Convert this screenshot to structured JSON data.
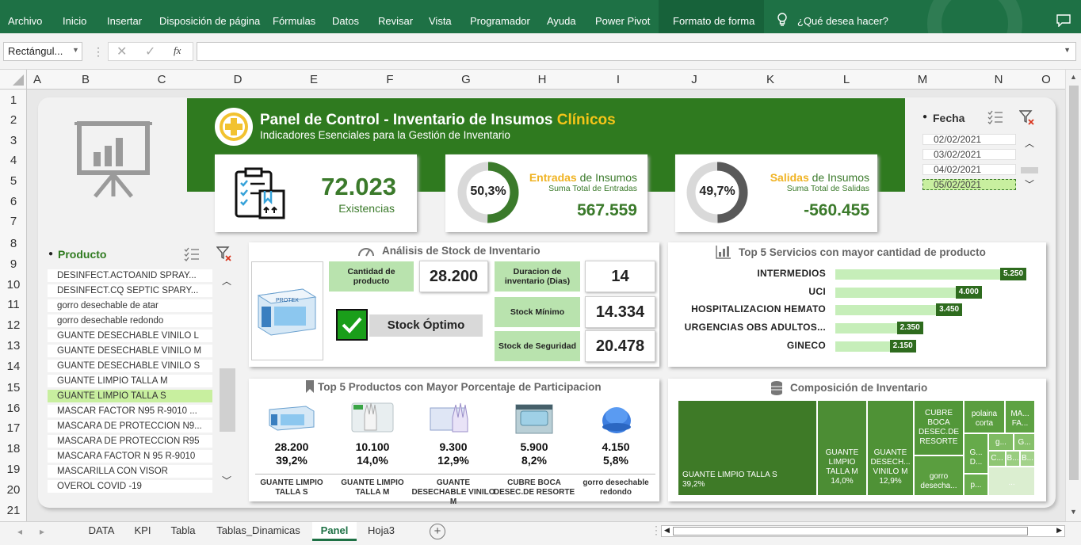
{
  "ribbon": {
    "tabs": [
      "Archivo",
      "Inicio",
      "Insertar",
      "Disposición de página",
      "Fórmulas",
      "Datos",
      "Revisar",
      "Vista",
      "Programador",
      "Ayuda",
      "Power Pivot",
      "Formato de forma"
    ],
    "tellme": "¿Qué desea hacer?"
  },
  "formula_bar": {
    "name_box": "Rectángul...",
    "fx": "fx",
    "formula": ""
  },
  "columns": [
    "A",
    "B",
    "C",
    "D",
    "E",
    "F",
    "G",
    "H",
    "I",
    "J",
    "K",
    "L",
    "M",
    "N",
    "O"
  ],
  "rows": [
    "1",
    "2",
    "3",
    "4",
    "5",
    "6",
    "7",
    "8",
    "9",
    "10",
    "11",
    "12",
    "13",
    "14",
    "15",
    "16",
    "17",
    "18",
    "19",
    "20",
    "21"
  ],
  "header": {
    "title_main": "Panel de Control - Inventario de Insumos ",
    "title_accent": "Clínicos",
    "subtitle": "Indicadores Esenciales para la Gestión de Inventario"
  },
  "kpis": {
    "existencias_value": "72.023",
    "existencias_label": "Existencias",
    "entradas_pct": "50,3%",
    "entradas_title_accent": "Entradas",
    "entradas_title_rest": " de Insumos",
    "entradas_sub": "Suma Total de Entradas",
    "entradas_value": "567.559",
    "entradas_fraction": 0.503,
    "salidas_pct": "49,7%",
    "salidas_title_accent": "Salidas",
    "salidas_title_rest": " de Insumos",
    "salidas_sub": "Suma Total de Salidas",
    "salidas_value": "-560.455",
    "salidas_fraction": 0.497
  },
  "fecha_slicer": {
    "title": "Fecha",
    "items": [
      "02/02/2021",
      "03/02/2021",
      "04/02/2021",
      "05/02/2021"
    ],
    "selected": "05/02/2021"
  },
  "producto_slicer": {
    "title": "Producto",
    "items": [
      "DESINFECT.ACTOANID SPRAY...",
      "DESINFECT.CQ SEPTIC SPARY...",
      "gorro desechable de atar",
      "gorro desechable redondo",
      "GUANTE DESECHABLE VINILO L",
      "GUANTE DESECHABLE VINILO M",
      "GUANTE DESECHABLE VINILO S",
      "GUANTE LIMPIO TALLA M",
      "GUANTE LIMPIO TALLA S",
      "MASCAR FACTOR N95 R-9010 ...",
      "MASCARA DE PROTECCION N9...",
      "MASCARA DE PROTECCION R95",
      "MASCARA FACTOR N 95 R-9010",
      "MASCARILLA CON  VISOR",
      "OVEROL COVID -19"
    ],
    "selected": "GUANTE LIMPIO TALLA S"
  },
  "stock_analysis": {
    "title": "Análisis de Stock de Inventario",
    "cantidad_label": "Cantidad de producto",
    "cantidad_value": "28.200",
    "status": "Stock Óptimo",
    "duracion_label": "Duracion de inventario (Dias)",
    "duracion_value": "14",
    "minimo_label": "Stock Mínimo",
    "minimo_value": "14.334",
    "seguridad_label": "Stock de Seguridad",
    "seguridad_value": "20.478"
  },
  "services": {
    "title": "Top 5 Servicios con mayor cantidad de producto",
    "items": [
      {
        "name": "INTERMEDIOS",
        "label": "5.250",
        "value": 5250
      },
      {
        "name": "UCI",
        "label": "4.000",
        "value": 4000
      },
      {
        "name": "HOSPITALIZACION HEMATO",
        "label": "3.450",
        "value": 3450
      },
      {
        "name": "URGENCIAS OBS ADULTOS...",
        "label": "2.350",
        "value": 2350
      },
      {
        "name": "GINECO",
        "label": "2.150",
        "value": 2150
      }
    ]
  },
  "top_products": {
    "title": "Top 5 Productos con Mayor Porcentaje de Participacion",
    "items": [
      {
        "value": "28.200",
        "pct": "39,2%",
        "name": "GUANTE LIMPIO TALLA S"
      },
      {
        "value": "10.100",
        "pct": "14,0%",
        "name": "GUANTE LIMPIO TALLA M"
      },
      {
        "value": "9.300",
        "pct": "12,9%",
        "name": "GUANTE DESECHABLE VINILO M"
      },
      {
        "value": "5.900",
        "pct": "8,2%",
        "name": "CUBRE BOCA DESEC.DE RESORTE"
      },
      {
        "value": "4.150",
        "pct": "5,8%",
        "name": "gorro desechable redondo"
      }
    ]
  },
  "composition": {
    "title": "Composición de Inventario",
    "big_name": "GUANTE LIMPIO TALLA S",
    "big_pct": "39,2%",
    "m_name": "GUANTE LIMPIO TALLA M",
    "m_pct": "14,0%",
    "v_name": "GUANTE DESECH... VINILO M",
    "v_pct": "12,9%",
    "cubre": "CUBRE BOCA DESEC.DE RESORTE",
    "polaina": "polaina corta",
    "ma": "MA... FA...",
    "gorro": "gorro desecha...",
    "g1": "G... D...",
    "g2": "g...",
    "g3": "G...",
    "c": "C...",
    "b1": "B...",
    "b2": "B...",
    "p": "p...",
    "more": "..."
  },
  "sheet_tabs": {
    "tabs": [
      "DATA",
      "KPI",
      "Tabla",
      "Tablas_Dinamicas",
      "Panel",
      "Hoja3"
    ],
    "active": "Panel"
  }
}
